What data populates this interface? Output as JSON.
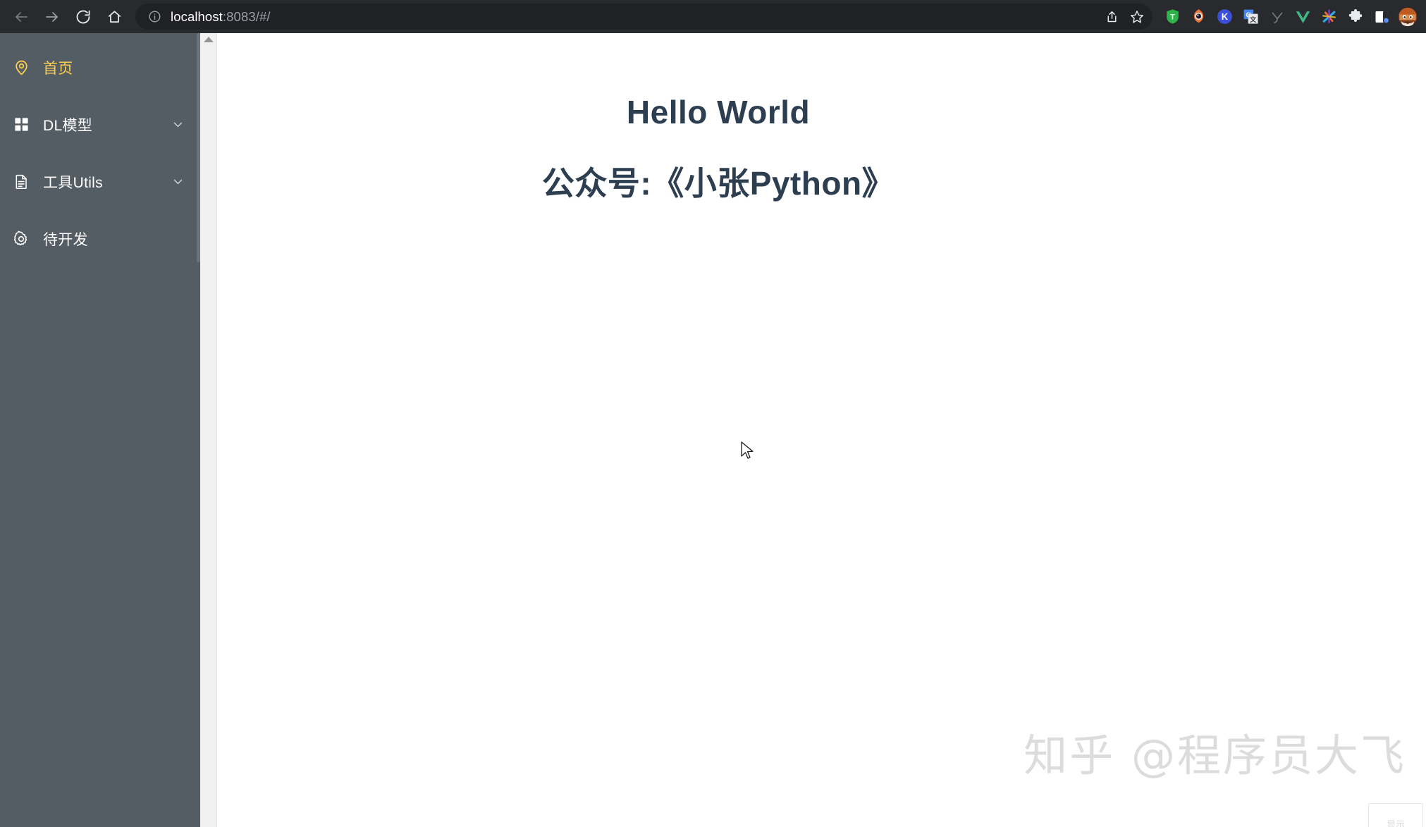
{
  "browser": {
    "nav": {
      "back": "back-arrow",
      "forward": "forward-arrow",
      "reload": "reload",
      "home": "home"
    },
    "omnibox": {
      "security_icon": "info-circle-icon",
      "host": "localhost",
      "path": ":8083/#/",
      "full_url": "localhost:8083/#/",
      "share_icon": "share-icon",
      "bookmark_icon": "star-icon"
    },
    "extensions": [
      {
        "name": "tampermonkey",
        "label": "T"
      },
      {
        "name": "eye-extension",
        "label": ""
      },
      {
        "name": "keepa-extension",
        "label": "K"
      },
      {
        "name": "google-translate",
        "label": "G"
      },
      {
        "name": "y-extension",
        "label": "y"
      },
      {
        "name": "vue-devtools",
        "label": "V"
      },
      {
        "name": "asterisk-extension",
        "label": ""
      },
      {
        "name": "extensions-puzzle",
        "label": ""
      },
      {
        "name": "side-panel",
        "label": ""
      },
      {
        "name": "profile-avatar",
        "label": ""
      }
    ]
  },
  "sidebar": {
    "background_color": "#545c64",
    "active_color": "#ffd04b",
    "items": [
      {
        "id": "home",
        "label": "首页",
        "icon": "location-pin-icon",
        "active": true,
        "expandable": false
      },
      {
        "id": "dl-model",
        "label": "DL模型",
        "icon": "grid-icon",
        "active": false,
        "expandable": true
      },
      {
        "id": "utils",
        "label": "工具Utils",
        "icon": "document-icon",
        "active": false,
        "expandable": true
      },
      {
        "id": "todo",
        "label": "待开发",
        "icon": "gear-icon",
        "active": false,
        "expandable": false
      }
    ]
  },
  "main": {
    "heading": "Hello World",
    "subheading": "公众号:《小张Python》",
    "heading_color": "#2c3e50",
    "watermark": "知乎 @程序员大飞",
    "corner_label": "显示"
  }
}
